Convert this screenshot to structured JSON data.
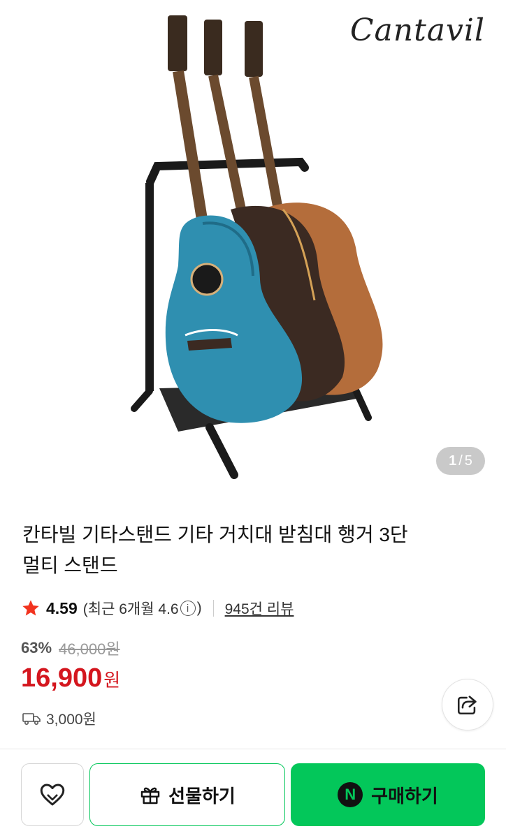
{
  "gallery": {
    "brand_logo": "Cantavil",
    "current_page": "1",
    "separator": "/",
    "total_pages": "5"
  },
  "product": {
    "title_line1": "칸타빌 기타스탠드 기타 거치대 받침대 행거 3단",
    "title_line2": "멀티 스탠드",
    "rating": "4.59",
    "rating_recent_prefix": "(최근 6개월 4.6",
    "rating_recent_suffix": ")",
    "review_count": "945건 리뷰",
    "discount_rate": "63%",
    "original_price": "46,000원",
    "sale_price": "16,900",
    "currency": "원",
    "shipping_fee": "3,000원"
  },
  "actions": {
    "gift_label": "선물하기",
    "buy_label": "구매하기",
    "npay_icon_letter": "N"
  },
  "icons": {
    "star": "star-icon",
    "info": "info-icon",
    "share": "share-icon",
    "truck": "truck-icon",
    "heart": "heart-icon",
    "gift": "gift-icon"
  },
  "colors": {
    "price_red": "#d4161e",
    "naver_green": "#03c75a",
    "star_red": "#f2331f"
  }
}
